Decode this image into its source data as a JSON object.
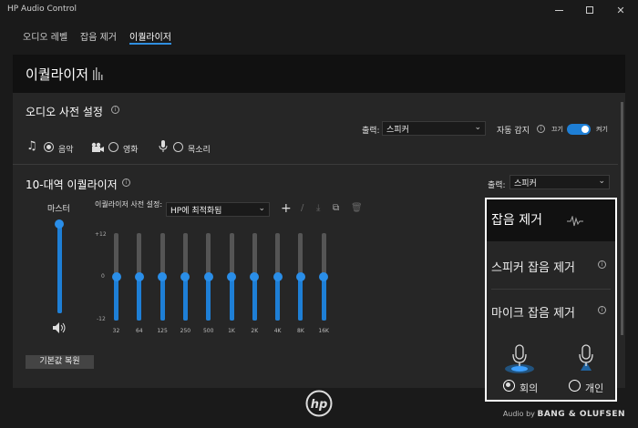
{
  "window": {
    "title": "HP Audio Control"
  },
  "tabs": [
    {
      "label": "오디오 레벨"
    },
    {
      "label": "잡음 제거"
    },
    {
      "label": "이퀄라이저"
    }
  ],
  "page": {
    "title": "이퀄라이저"
  },
  "presets": {
    "title": "오디오 사전 설정",
    "output_label": "출력:",
    "output_value": "스피커",
    "auto_detect_label": "자동 감지",
    "toggle_off": "끄기",
    "toggle_on": "켜기",
    "options": [
      {
        "label": "음악",
        "selected": true
      },
      {
        "label": "영화",
        "selected": false
      },
      {
        "label": "목소리",
        "selected": false
      }
    ]
  },
  "equalizer": {
    "title": "10-대역 이퀄라이저",
    "output_label": "출력:",
    "output_value": "스피커",
    "master_label": "마스터",
    "master_level": 1.0,
    "preset_label": "이퀄라이저 사전 설정:",
    "preset_value": "HP에 최적화됨",
    "scale_top": "+12",
    "scale_mid": "0",
    "scale_bottom": "-12",
    "bands": [
      {
        "label": "32",
        "gain": 0
      },
      {
        "label": "64",
        "gain": 0
      },
      {
        "label": "125",
        "gain": 0
      },
      {
        "label": "250",
        "gain": 0
      },
      {
        "label": "500",
        "gain": 0
      },
      {
        "label": "1K",
        "gain": 0
      },
      {
        "label": "2K",
        "gain": 0
      },
      {
        "label": "4K",
        "gain": 0
      },
      {
        "label": "8K",
        "gain": 0
      },
      {
        "label": "16K",
        "gain": 0
      }
    ],
    "reset_label": "기본값 복원"
  },
  "noise_popup": {
    "title": "잡음 제거",
    "speaker_label": "스피커 잡음 제거",
    "mic_label": "마이크 잡음 제거",
    "mode_meeting": "회의",
    "mode_personal": "개인",
    "selected_mode": "meeting"
  },
  "footer": {
    "audio_by": "Audio by",
    "brand": "BANG & OLUFSEN"
  },
  "colors": {
    "accent": "#1e7fd6",
    "background": "#1a1a1a",
    "panel": "#262626"
  }
}
